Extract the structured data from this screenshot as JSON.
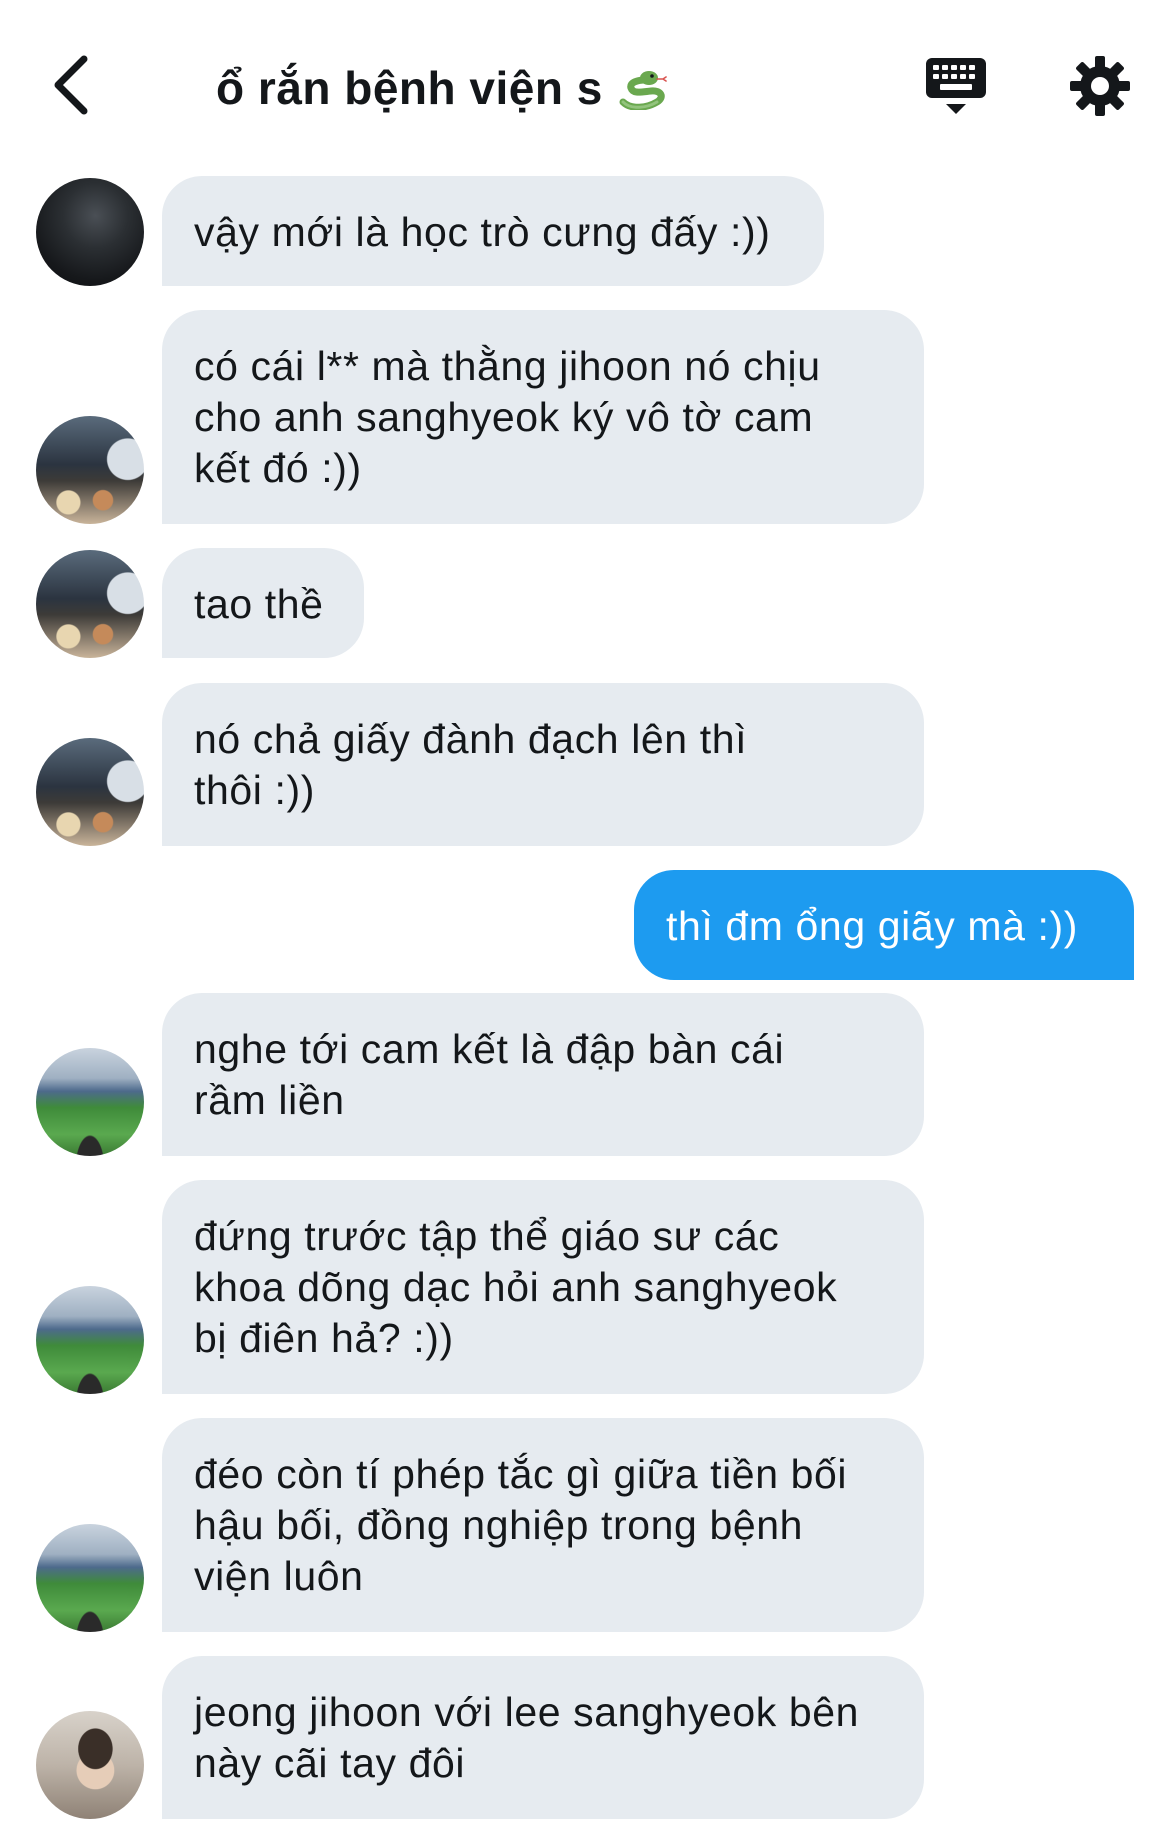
{
  "header": {
    "title": "ổ rắn bệnh viện s",
    "title_emoji_icon": "snake-icon",
    "back_icon": "chevron-left-icon",
    "keyboard_icon": "keyboard-icon",
    "settings_icon": "gear-icon"
  },
  "colors": {
    "incoming_bubble": "#e6ebf0",
    "outgoing_bubble": "#1d9bf0",
    "text": "#14171a"
  },
  "messages": [
    {
      "direction": "in",
      "avatar": "dark",
      "text": "vậy mới là học trò cưng đấy :))"
    },
    {
      "direction": "in",
      "avatar": "food",
      "text": "có cái l** mà thằng jihoon nó chịu\ncho anh sanghyeok ký vô tờ cam\nkết đó :))"
    },
    {
      "direction": "in",
      "avatar": "food",
      "text": "tao thề"
    },
    {
      "direction": "in",
      "avatar": "food",
      "text": "nó chả giấy đành đạch lên thì\nthôi :))"
    },
    {
      "direction": "out",
      "avatar": null,
      "text": "thì đm ổng giãy mà :))"
    },
    {
      "direction": "in",
      "avatar": "stadium",
      "text": "nghe tới cam kết là đập bàn cái\nrầm liền"
    },
    {
      "direction": "in",
      "avatar": "stadium",
      "text": "đứng trước tập thể giáo sư các\nkhoa dõng dạc hỏi anh sanghyeok\nbị điên hả? :))"
    },
    {
      "direction": "in",
      "avatar": "stadium",
      "text": "đéo còn tí phép tắc gì giữa tiền bối\nhậu bối, đồng nghiệp trong bệnh\nviện luôn"
    },
    {
      "direction": "in",
      "avatar": "person",
      "text": "jeong jihoon với lee sanghyeok bên\nnày cãi tay đôi"
    }
  ]
}
